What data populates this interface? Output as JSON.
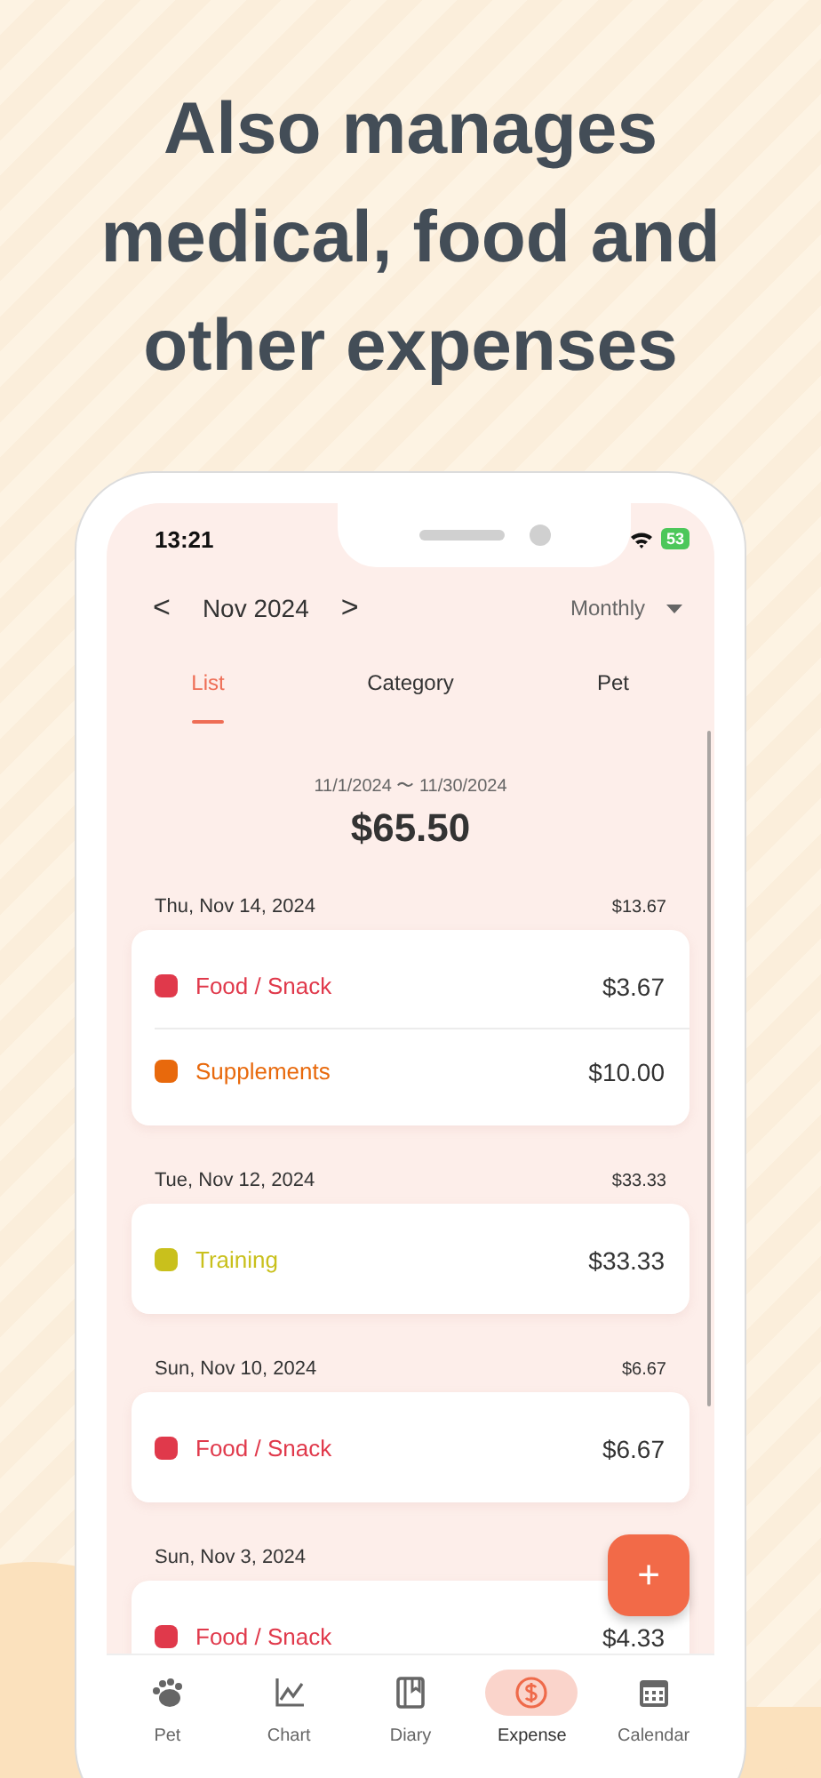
{
  "headline": [
    "Also manages",
    "medical, food and",
    "other expenses"
  ],
  "status_bar": {
    "time": "13:21",
    "battery": "53"
  },
  "header": {
    "month": "Nov 2024",
    "prev": "<",
    "next": ">",
    "period": "Monthly"
  },
  "tabs": [
    {
      "label": "List",
      "selected": true
    },
    {
      "label": "Category",
      "selected": false
    },
    {
      "label": "Pet",
      "selected": false
    }
  ],
  "summary": {
    "range": "11/1/2024 〜 11/30/2024",
    "total": "$65.50"
  },
  "days": [
    {
      "date": "Thu, Nov 14, 2024",
      "total": "$13.67",
      "entries": [
        {
          "category": "Food / Snack",
          "color": "#e0394b",
          "amount": "$3.67"
        },
        {
          "category": "Supplements",
          "color": "#e8690c",
          "amount": "$10.00"
        }
      ]
    },
    {
      "date": "Tue, Nov 12, 2024",
      "total": "$33.33",
      "entries": [
        {
          "category": "Training",
          "color": "#c9c01c",
          "amount": "$33.33"
        }
      ]
    },
    {
      "date": "Sun, Nov 10, 2024",
      "total": "$6.67",
      "entries": [
        {
          "category": "Food / Snack",
          "color": "#e0394b",
          "amount": "$6.67"
        }
      ]
    },
    {
      "date": "Sun, Nov 3, 2024",
      "entries": [
        {
          "category": "Food / Snack",
          "color": "#e0394b",
          "amount": "$4.33"
        }
      ]
    }
  ],
  "fab": {
    "label": "+"
  },
  "nav": [
    {
      "label": "Pet",
      "kind": "paw",
      "selected": false
    },
    {
      "label": "Chart",
      "kind": "chart",
      "selected": false
    },
    {
      "label": "Diary",
      "kind": "book",
      "selected": false
    },
    {
      "label": "Expense",
      "kind": "dollar",
      "selected": true
    },
    {
      "label": "Calendar",
      "kind": "calendar",
      "selected": false
    }
  ]
}
